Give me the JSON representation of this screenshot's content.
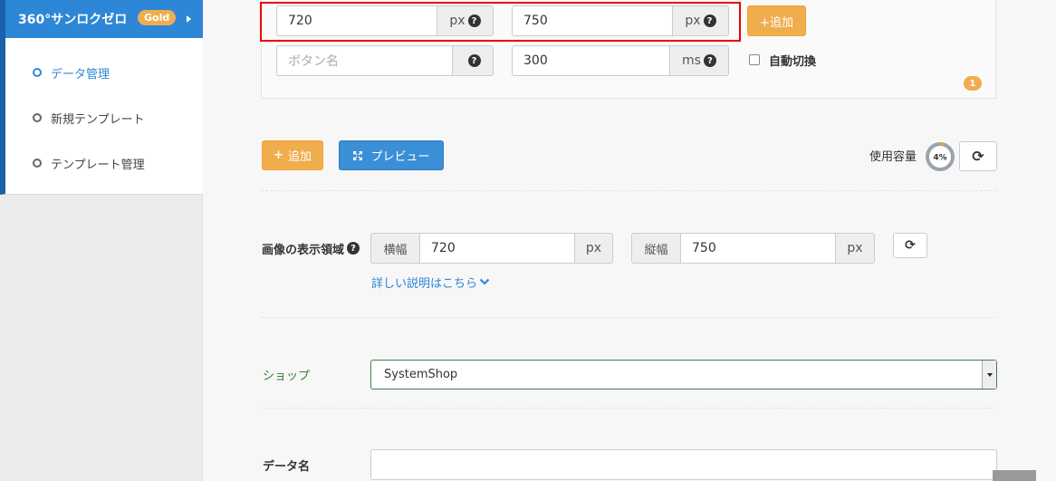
{
  "sidebar": {
    "brand": "360°サンロクゼロ",
    "badge": "Gold",
    "items": [
      {
        "label": "データ管理",
        "active": true
      },
      {
        "label": "新規テンプレート",
        "active": false
      },
      {
        "label": "テンプレート管理",
        "active": false
      }
    ]
  },
  "panel": {
    "width_value": "720",
    "width_unit": "px",
    "height_value": "750",
    "height_unit": "px",
    "add_label": "+追加",
    "button_name_placeholder": "ボタン名",
    "duration_value": "300",
    "duration_unit": "ms",
    "auto_switch_label": "自動切換",
    "count_badge": "1"
  },
  "toolbar": {
    "add_label": "追加",
    "preview_label": "プレビュー",
    "usage_label": "使用容量",
    "usage_percent": "4%",
    "usage_fraction": 0.04
  },
  "display_area": {
    "label": "画像の表示領域",
    "width_label": "横幅",
    "width_value": "720",
    "width_unit": "px",
    "height_label": "縦幅",
    "height_value": "750",
    "height_unit": "px",
    "details_link": "詳しい説明はこちら"
  },
  "shop": {
    "label": "ショップ",
    "selected": "SystemShop"
  },
  "data_name": {
    "label": "データ名",
    "value": ""
  },
  "icons": {
    "help": "question-circle-icon",
    "refresh": "refresh-icon",
    "expand": "expand-icon",
    "plus": "plus-icon",
    "chevron": "chevron-down-icon"
  },
  "colors": {
    "brand_blue": "#2e86d6",
    "orange": "#f0ad4e",
    "green_label": "#3a7a3a",
    "highlight_red": "#e00000"
  }
}
